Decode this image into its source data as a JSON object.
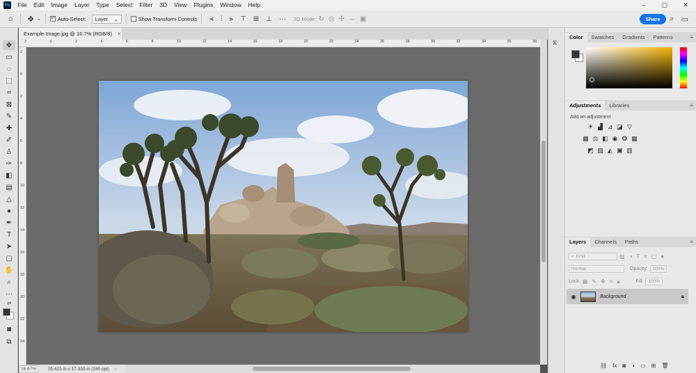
{
  "menubar": {
    "app_logo": "Ps",
    "items": [
      "File",
      "Edit",
      "Image",
      "Layer",
      "Type",
      "Select",
      "Filter",
      "3D",
      "View",
      "Plugins",
      "Window",
      "Help"
    ],
    "window_controls": [
      "–",
      "▢",
      "✕"
    ]
  },
  "options_bar": {
    "auto_select_label": "Auto-Select:",
    "auto_select_checked": true,
    "auto_select_target": "Layer",
    "show_transform_label": "Show Transform Controls",
    "show_transform_checked": false,
    "mode_3d_label": "3D Mode:",
    "more": "···",
    "share_label": "Share"
  },
  "document": {
    "tab_title": "Example Image.jpg @ 16.7% (RGB/8)",
    "close": "×",
    "zoom": "16.67%",
    "info": "25.421 in x 17.333 in (240 ppi)",
    "status_arrow": "›"
  },
  "rulers": {
    "top": [
      "2",
      "0",
      "2",
      "4",
      "6",
      "8",
      "10",
      "12",
      "14",
      "16",
      "18",
      "20",
      "22",
      "24",
      "26",
      "28",
      "30",
      "32",
      "34",
      "36",
      "38"
    ],
    "left": [
      "2",
      "0",
      "2",
      "4",
      "6",
      "8",
      "10",
      "12",
      "14",
      "16",
      "18",
      "20",
      "22",
      "24"
    ]
  },
  "color_panel": {
    "tabs": [
      "Color",
      "Swatches",
      "Gradients",
      "Patterns"
    ],
    "active_tab": "Color",
    "foreground": "#333333",
    "background": "#ffffff",
    "hue_color": "#f3b200"
  },
  "adjustments_panel": {
    "tabs": [
      "Adjustments",
      "Libraries"
    ],
    "active_tab": "Adjustments",
    "add_label": "Add an adjustment"
  },
  "layers_panel": {
    "tabs": [
      "Layers",
      "Channels",
      "Paths"
    ],
    "active_tab": "Layers",
    "kind_label": "Kind",
    "blend_mode": "Normal",
    "opacity_label": "Opacity:",
    "opacity_value": "100%",
    "lock_label": "Lock:",
    "fill_label": "Fill:",
    "fill_value": "100%",
    "layers": [
      {
        "name": "Background",
        "visible": true,
        "locked": true
      }
    ]
  }
}
